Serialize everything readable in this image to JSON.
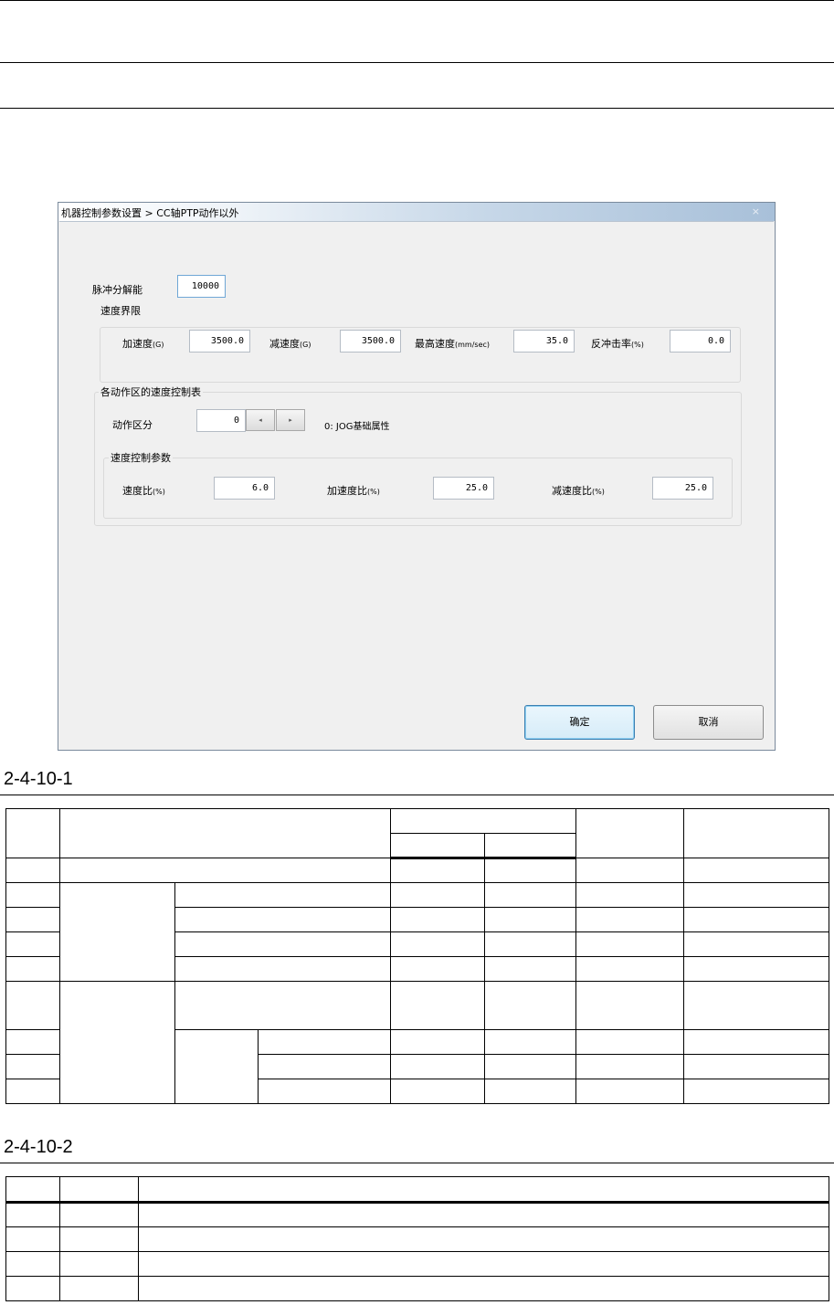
{
  "dialog": {
    "title": "机器控制参数设置 > CC轴PTP动作以外",
    "close_glyph": "×",
    "pulse_resolution": {
      "label": "脉冲分解能",
      "value": "10000"
    },
    "speed_limit": {
      "title": "速度界限",
      "accel": {
        "label": "加速度",
        "unit": "(G)",
        "value": "3500.0"
      },
      "decel": {
        "label": "减速度",
        "unit": "(G)",
        "value": "3500.0"
      },
      "max_speed": {
        "label": "最高速度",
        "unit": "(mm/sec)",
        "value": "35.0"
      },
      "rebound": {
        "label": "反冲击率",
        "unit": "(%)",
        "value": "0.0"
      }
    },
    "zone_table": {
      "title": "各动作区的速度控制表",
      "zone": {
        "label": "动作区分",
        "value": "0",
        "prev": "◂",
        "next": "▸",
        "desc": "0: JOG基础属性"
      },
      "params": {
        "title": "速度控制参数",
        "speed_ratio": {
          "label": "速度比",
          "unit": "(%)",
          "value": "6.0"
        },
        "accel_ratio": {
          "label": "加速度比",
          "unit": "(%)",
          "value": "25.0"
        },
        "decel_ratio": {
          "label": "减速度比",
          "unit": "(%)",
          "value": "25.0"
        }
      }
    },
    "ok_label": "确定",
    "cancel_label": "取消"
  },
  "captions": {
    "fig": "2-4-10-1",
    "table": "2-4-10-2"
  }
}
